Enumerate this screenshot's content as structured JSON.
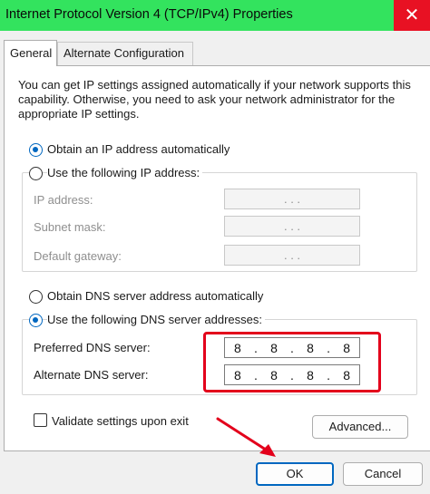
{
  "window": {
    "title": "Internet Protocol Version 4 (TCP/IPv4) Properties",
    "close_glyph": "✕"
  },
  "tabs": [
    {
      "label": "General",
      "selected": true
    },
    {
      "label": "Alternate Configuration",
      "selected": false
    }
  ],
  "intro": "You can get IP settings assigned automatically if your network supports this capability. Otherwise, you need to ask your network administrator for the appropriate IP settings.",
  "ip_mode": {
    "auto_label": "Obtain an IP address automatically",
    "manual_label": "Use the following IP address:",
    "selected": "auto"
  },
  "ip_fields": [
    {
      "label": "IP address:",
      "value": ". . ."
    },
    {
      "label": "Subnet mask:",
      "value": ". . ."
    },
    {
      "label": "Default gateway:",
      "value": ". . ."
    }
  ],
  "dns_mode": {
    "auto_label": "Obtain DNS server address automatically",
    "manual_label": "Use the following DNS server addresses:",
    "selected": "manual"
  },
  "dns_fields": [
    {
      "label": "Preferred DNS server:",
      "octets": [
        "8",
        ".",
        "8",
        ".",
        "8",
        ".",
        "8"
      ]
    },
    {
      "label": "Alternate DNS server:",
      "octets": [
        "8",
        ".",
        "8",
        ".",
        "8",
        ".",
        "8"
      ]
    }
  ],
  "validate_label": "Validate settings upon exit",
  "buttons": {
    "advanced": "Advanced...",
    "ok": "OK",
    "cancel": "Cancel"
  },
  "annotation_colors": {
    "highlight_box": "#e3001b",
    "arrow": "#e3001b",
    "titlebar": "#33e35e"
  }
}
